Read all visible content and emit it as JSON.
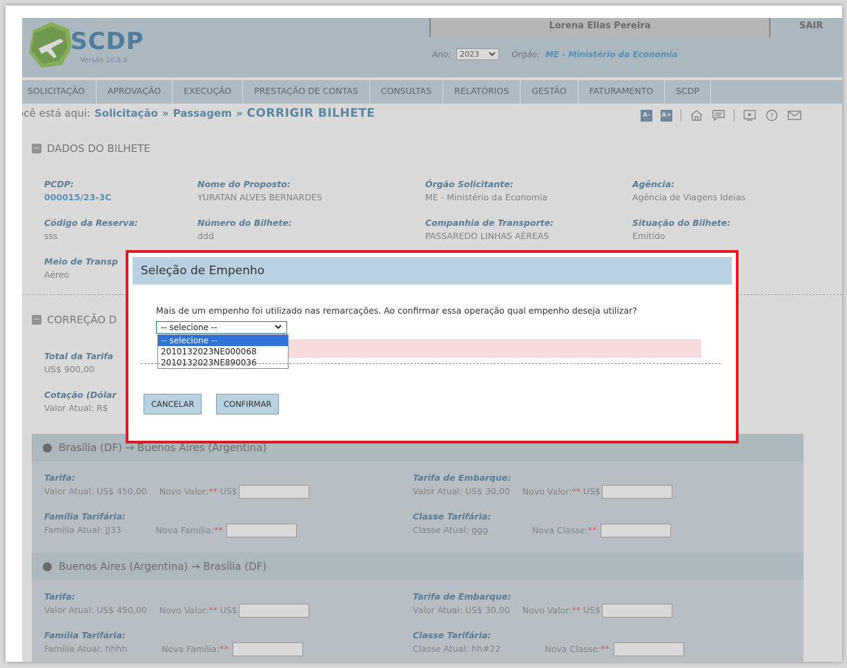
{
  "header": {
    "logo_title": "SCDP",
    "logo_version": "Versão 10.8.0",
    "user_name": "Lorena Elias Pereira",
    "logout": "SAIR",
    "ano_label": "Ano:",
    "ano_value": "2023",
    "orgao_label": "Órgão:",
    "orgao_value": "ME - Ministério da Economia"
  },
  "nav": [
    "SOLICITAÇÃO",
    "APROVAÇÃO",
    "EXECUÇÃO",
    "PRESTAÇÃO DE CONTAS",
    "CONSULTAS",
    "RELATÓRIOS",
    "GESTÃO",
    "FATURAMENTO",
    "SCDP"
  ],
  "breadcrumb": {
    "prefix": "Você está aqui:",
    "level1": "Solicitação",
    "level2": "Passagem",
    "current": "CORRIGIR BILHETE"
  },
  "tools": {
    "font_decrease": "A-",
    "font_increase": "A+"
  },
  "dados": {
    "title": "DADOS DO BILHETE",
    "pcdp_label": "PCDP:",
    "pcdp_value": "000015/23-3C",
    "nome_label": "Nome do Proposto:",
    "nome_value": "YURATAN ALVES BERNARDES",
    "orgao_label": "Órgão Solicitante:",
    "orgao_value": "ME - Ministério da Economia",
    "agencia_label": "Agência:",
    "agencia_value": "Agência de Viagens Ideias",
    "codigo_label": "Código da Reserva:",
    "codigo_value": "sss",
    "numero_label": "Número do Bilhete:",
    "numero_value": "ddd",
    "companhia_label": "Companhia de Transporte:",
    "companhia_value": "PASSAREDO LINHAS AÉREAS",
    "situacao_label": "Situação do Bilhete:",
    "situacao_value": "Emitido",
    "meio_label": "Meio de Transp",
    "meio_value": "Aéreo"
  },
  "correcao": {
    "title": "CORREÇÃO D",
    "total_label": "Total da Tarifa",
    "total_value": "US$ 900,00",
    "cotacao_label": "Cotação (Dólar",
    "cotacao_value": "Valor Atual: R$"
  },
  "routes": [
    {
      "title": "Brasília (DF) → Buenos Aires (Argentina)",
      "tarifa_label": "Tarifa:",
      "tarifa_atual": "Valor Atual: US$ 450,00",
      "tarifa_novo": "Novo Valor:",
      "tarifa_mark": "**",
      "tarifa_cur": "US$",
      "embarque_label": "Tarifa de Embarque:",
      "embarque_atual": "Valor Atual: US$ 30,00",
      "embarque_novo": "Novo Valor:",
      "embarque_mark": "**",
      "embarque_cur": "US$",
      "familia_label": "Família Tarifária:",
      "familia_atual": "Família Atual: JJ33",
      "familia_nova": "Nova Família:",
      "familia_mark": "**",
      "classe_label": "Classe Tarifária:",
      "classe_atual": "Classe Atual: ggg",
      "classe_nova": "Nova Classe:",
      "classe_mark": "**"
    },
    {
      "title": "Buenos Aires (Argentina) → Brasília (DF)",
      "tarifa_label": "Tarifa:",
      "tarifa_atual": "Valor Atual: US$ 450,00",
      "tarifa_novo": "Novo Valor:",
      "tarifa_mark": "**",
      "tarifa_cur": "US$",
      "embarque_label": "Tarifa de Embarque:",
      "embarque_atual": "Valor Atual: US$ 30,00",
      "embarque_novo": "Novo Valor:",
      "embarque_mark": "**",
      "embarque_cur": "US$",
      "familia_label": "Família Tarifária:",
      "familia_atual": "Família Atual: hhhh",
      "familia_nova": "Nova Família:",
      "familia_mark": "**",
      "classe_label": "Classe Tarifária:",
      "classe_atual": "Classe Atual: hh#22",
      "classe_nova": "Nova Classe:",
      "classe_mark": "**"
    }
  ],
  "modal": {
    "title": "Seleção de Empenho",
    "message": "Mais de um empenho foi utilizado nas remarcações. Ao confirmar essa operação qual empenho deseja utilizar?",
    "select_value": "-- selecione --",
    "options": [
      "-- selecione --",
      "2010132023NE000068",
      "2010132023NE890036"
    ],
    "cancel": "CANCELAR",
    "confirm": "CONFIRMAR"
  },
  "colors": {
    "highlight_border": "#e01b24",
    "accent": "#3b7ea8",
    "header_bg": "#b9cbd6"
  }
}
